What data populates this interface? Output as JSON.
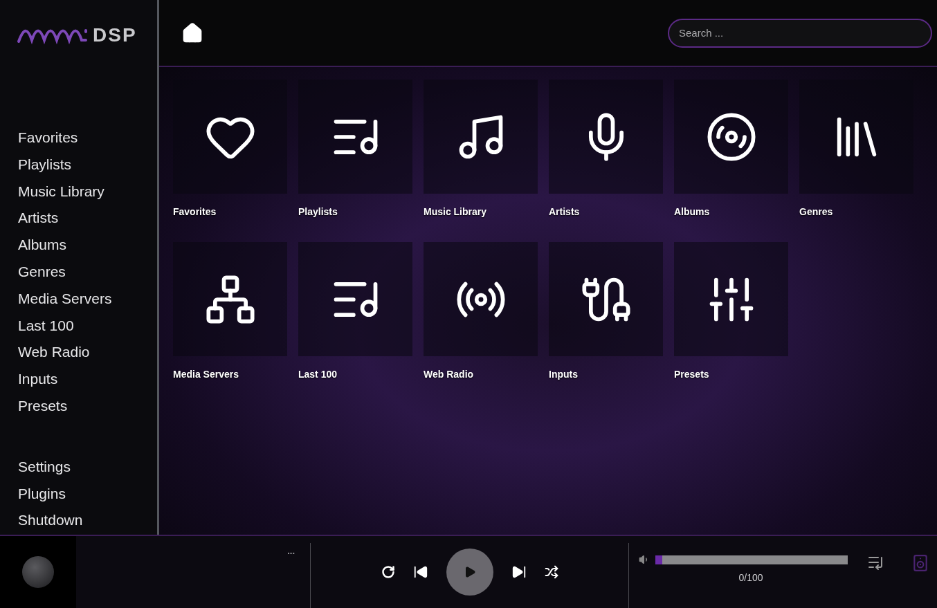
{
  "logo": {
    "text": "DSP"
  },
  "search": {
    "placeholder": "Search ..."
  },
  "sidebar": {
    "items": [
      {
        "label": "Favorites"
      },
      {
        "label": "Playlists"
      },
      {
        "label": "Music Library"
      },
      {
        "label": "Artists"
      },
      {
        "label": "Albums"
      },
      {
        "label": "Genres"
      },
      {
        "label": "Media Servers"
      },
      {
        "label": "Last 100"
      },
      {
        "label": "Web Radio"
      },
      {
        "label": "Inputs"
      },
      {
        "label": "Presets"
      }
    ],
    "system_items": [
      {
        "label": "Settings"
      },
      {
        "label": "Plugins"
      },
      {
        "label": "Shutdown"
      }
    ]
  },
  "tiles": [
    {
      "label": "Favorites"
    },
    {
      "label": "Playlists"
    },
    {
      "label": "Music Library"
    },
    {
      "label": "Artists"
    },
    {
      "label": "Albums"
    },
    {
      "label": "Genres"
    },
    {
      "label": "Media Servers"
    },
    {
      "label": "Last 100"
    },
    {
      "label": "Web Radio"
    },
    {
      "label": "Inputs"
    },
    {
      "label": "Presets"
    }
  ],
  "player": {
    "more": "...",
    "volume": {
      "level": 0.0,
      "reading": "0/100"
    }
  }
}
